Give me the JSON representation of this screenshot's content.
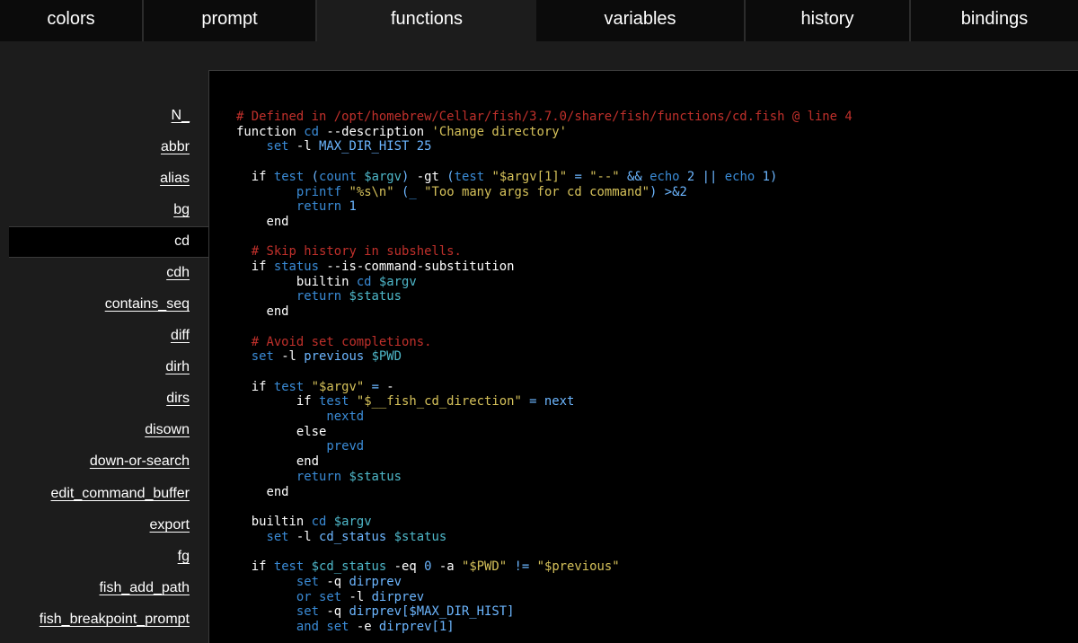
{
  "colors": {
    "comment": "#c0302b",
    "keyword": "#ffffff",
    "builtin": "#3a8bd6",
    "param": "#6cb6ff",
    "string": "#d5c15a",
    "variable": "#4eb7c9",
    "panel_bg": "#000000",
    "page_bg": "#1c1c1c"
  },
  "tabs": [
    {
      "label": "colors"
    },
    {
      "label": "prompt"
    },
    {
      "label": "functions",
      "active": true
    },
    {
      "label": "variables"
    },
    {
      "label": "history"
    },
    {
      "label": "bindings"
    }
  ],
  "functions": {
    "items": [
      "N_",
      "abbr",
      "alias",
      "bg",
      "cd",
      "cdh",
      "contains_seq",
      "diff",
      "dirh",
      "dirs",
      "disown",
      "down-or-search",
      "edit_command_buffer",
      "export",
      "fg",
      "fish_add_path",
      "fish_breakpoint_prompt"
    ],
    "selected": "cd"
  },
  "code": {
    "lines": [
      [
        {
          "t": "# Defined in /opt/homebrew/Cellar/fish/3.7.0/share/fish/functions/cd.fish @ line 4",
          "c": "t-c"
        }
      ],
      [
        {
          "t": "function ",
          "c": "t-k"
        },
        {
          "t": "cd",
          "c": "t-b"
        },
        {
          "t": " --description ",
          "c": "t-k"
        },
        {
          "t": "'Change directory'",
          "c": "t-s"
        }
      ],
      [
        {
          "t": "    ",
          "c": ""
        },
        {
          "t": "set",
          "c": "t-b"
        },
        {
          "t": " -l ",
          "c": "t-k"
        },
        {
          "t": "MAX_DIR_HIST",
          "c": "t-p"
        },
        {
          "t": " ",
          "c": ""
        },
        {
          "t": "25",
          "c": "t-p"
        }
      ],
      [
        {
          "t": "",
          "c": ""
        }
      ],
      [
        {
          "t": "  if ",
          "c": "t-k"
        },
        {
          "t": "test",
          "c": "t-b"
        },
        {
          "t": " (",
          "c": "t-p"
        },
        {
          "t": "count",
          "c": "t-b"
        },
        {
          "t": " ",
          "c": ""
        },
        {
          "t": "$argv",
          "c": "t-v"
        },
        {
          "t": ")",
          "c": "t-p"
        },
        {
          "t": " -gt ",
          "c": "t-k"
        },
        {
          "t": "(",
          "c": "t-p"
        },
        {
          "t": "test",
          "c": "t-b"
        },
        {
          "t": " ",
          "c": ""
        },
        {
          "t": "\"$argv[1]\"",
          "c": "t-s"
        },
        {
          "t": " = ",
          "c": "t-p"
        },
        {
          "t": "\"--\"",
          "c": "t-s"
        },
        {
          "t": " && ",
          "c": "t-p"
        },
        {
          "t": "echo",
          "c": "t-b"
        },
        {
          "t": " ",
          "c": ""
        },
        {
          "t": "2",
          "c": "t-p"
        },
        {
          "t": " || ",
          "c": "t-p"
        },
        {
          "t": "echo",
          "c": "t-b"
        },
        {
          "t": " ",
          "c": ""
        },
        {
          "t": "1",
          "c": "t-p"
        },
        {
          "t": ")",
          "c": "t-p"
        }
      ],
      [
        {
          "t": "        ",
          "c": ""
        },
        {
          "t": "printf",
          "c": "t-b"
        },
        {
          "t": " ",
          "c": ""
        },
        {
          "t": "\"%s\\n\"",
          "c": "t-s"
        },
        {
          "t": " (",
          "c": "t-p"
        },
        {
          "t": "_",
          "c": "t-b"
        },
        {
          "t": " ",
          "c": ""
        },
        {
          "t": "\"Too many args for cd command\"",
          "c": "t-s"
        },
        {
          "t": ")",
          "c": "t-p"
        },
        {
          "t": " >&2",
          "c": "t-p"
        }
      ],
      [
        {
          "t": "        ",
          "c": ""
        },
        {
          "t": "return",
          "c": "t-b"
        },
        {
          "t": " ",
          "c": ""
        },
        {
          "t": "1",
          "c": "t-p"
        }
      ],
      [
        {
          "t": "    end",
          "c": "t-k"
        }
      ],
      [
        {
          "t": "",
          "c": ""
        }
      ],
      [
        {
          "t": "  # Skip history in subshells.",
          "c": "t-c"
        }
      ],
      [
        {
          "t": "  if ",
          "c": "t-k"
        },
        {
          "t": "status",
          "c": "t-b"
        },
        {
          "t": " --is-command-substitution",
          "c": "t-k"
        }
      ],
      [
        {
          "t": "        builtin ",
          "c": "t-k"
        },
        {
          "t": "cd",
          "c": "t-b"
        },
        {
          "t": " ",
          "c": ""
        },
        {
          "t": "$argv",
          "c": "t-v"
        }
      ],
      [
        {
          "t": "        ",
          "c": ""
        },
        {
          "t": "return",
          "c": "t-b"
        },
        {
          "t": " ",
          "c": ""
        },
        {
          "t": "$status",
          "c": "t-v"
        }
      ],
      [
        {
          "t": "    end",
          "c": "t-k"
        }
      ],
      [
        {
          "t": "",
          "c": ""
        }
      ],
      [
        {
          "t": "  # Avoid set completions.",
          "c": "t-c"
        }
      ],
      [
        {
          "t": "  ",
          "c": ""
        },
        {
          "t": "set",
          "c": "t-b"
        },
        {
          "t": " -l ",
          "c": "t-k"
        },
        {
          "t": "previous",
          "c": "t-p"
        },
        {
          "t": " ",
          "c": ""
        },
        {
          "t": "$PWD",
          "c": "t-v"
        }
      ],
      [
        {
          "t": "",
          "c": ""
        }
      ],
      [
        {
          "t": "  if ",
          "c": "t-k"
        },
        {
          "t": "test",
          "c": "t-b"
        },
        {
          "t": " ",
          "c": ""
        },
        {
          "t": "\"$argv\"",
          "c": "t-s"
        },
        {
          "t": " = ",
          "c": "t-p"
        },
        {
          "t": "-",
          "c": "t-k"
        }
      ],
      [
        {
          "t": "        if ",
          "c": "t-k"
        },
        {
          "t": "test",
          "c": "t-b"
        },
        {
          "t": " ",
          "c": ""
        },
        {
          "t": "\"$__fish_cd_direction\"",
          "c": "t-s"
        },
        {
          "t": " = ",
          "c": "t-p"
        },
        {
          "t": "next",
          "c": "t-p"
        }
      ],
      [
        {
          "t": "            ",
          "c": ""
        },
        {
          "t": "nextd",
          "c": "t-b"
        }
      ],
      [
        {
          "t": "        else",
          "c": "t-k"
        }
      ],
      [
        {
          "t": "            ",
          "c": ""
        },
        {
          "t": "prevd",
          "c": "t-b"
        }
      ],
      [
        {
          "t": "        end",
          "c": "t-k"
        }
      ],
      [
        {
          "t": "        ",
          "c": ""
        },
        {
          "t": "return",
          "c": "t-b"
        },
        {
          "t": " ",
          "c": ""
        },
        {
          "t": "$status",
          "c": "t-v"
        }
      ],
      [
        {
          "t": "    end",
          "c": "t-k"
        }
      ],
      [
        {
          "t": "",
          "c": ""
        }
      ],
      [
        {
          "t": "  builtin ",
          "c": "t-k"
        },
        {
          "t": "cd",
          "c": "t-b"
        },
        {
          "t": " ",
          "c": ""
        },
        {
          "t": "$argv",
          "c": "t-v"
        }
      ],
      [
        {
          "t": "    ",
          "c": ""
        },
        {
          "t": "set",
          "c": "t-b"
        },
        {
          "t": " -l ",
          "c": "t-k"
        },
        {
          "t": "cd_status",
          "c": "t-p"
        },
        {
          "t": " ",
          "c": ""
        },
        {
          "t": "$status",
          "c": "t-v"
        }
      ],
      [
        {
          "t": "",
          "c": ""
        }
      ],
      [
        {
          "t": "  if ",
          "c": "t-k"
        },
        {
          "t": "test",
          "c": "t-b"
        },
        {
          "t": " ",
          "c": ""
        },
        {
          "t": "$cd_status",
          "c": "t-v"
        },
        {
          "t": " -eq ",
          "c": "t-k"
        },
        {
          "t": "0",
          "c": "t-p"
        },
        {
          "t": " -a ",
          "c": "t-k"
        },
        {
          "t": "\"$PWD\"",
          "c": "t-s"
        },
        {
          "t": " != ",
          "c": "t-p"
        },
        {
          "t": "\"$previous\"",
          "c": "t-s"
        }
      ],
      [
        {
          "t": "        ",
          "c": ""
        },
        {
          "t": "set",
          "c": "t-b"
        },
        {
          "t": " -q ",
          "c": "t-k"
        },
        {
          "t": "dirprev",
          "c": "t-p"
        }
      ],
      [
        {
          "t": "        ",
          "c": ""
        },
        {
          "t": "or",
          "c": "t-b"
        },
        {
          "t": " ",
          "c": ""
        },
        {
          "t": "set",
          "c": "t-b"
        },
        {
          "t": " -l ",
          "c": "t-k"
        },
        {
          "t": "dirprev",
          "c": "t-p"
        }
      ],
      [
        {
          "t": "        ",
          "c": ""
        },
        {
          "t": "set",
          "c": "t-b"
        },
        {
          "t": " -q ",
          "c": "t-k"
        },
        {
          "t": "dirprev[$MAX_DIR_HIST]",
          "c": "t-p"
        }
      ],
      [
        {
          "t": "        ",
          "c": ""
        },
        {
          "t": "and",
          "c": "t-b"
        },
        {
          "t": " ",
          "c": ""
        },
        {
          "t": "set",
          "c": "t-b"
        },
        {
          "t": " -e ",
          "c": "t-k"
        },
        {
          "t": "dirprev[1]",
          "c": "t-p"
        }
      ]
    ]
  }
}
